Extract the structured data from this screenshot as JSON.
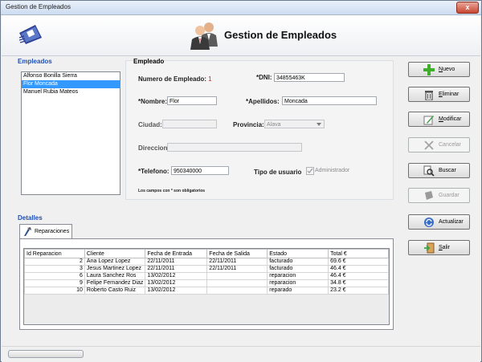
{
  "window": {
    "title": "Gestion de Empleados",
    "close_glyph": "x"
  },
  "header": {
    "title": "Gestion de Empleados"
  },
  "employees": {
    "section_label": "Empleados",
    "items": [
      {
        "label": "Alfonso Bonilla Sierra",
        "selected": false
      },
      {
        "label": "Flor Moncada",
        "selected": true
      },
      {
        "label": "Manuel Rubia Mateos",
        "selected": false
      }
    ]
  },
  "form": {
    "section_label": "Empleado",
    "numero_label": "Numero de Empleado:",
    "numero_value": "1",
    "dni_label": "*DNI:",
    "dni_value": "34855463K",
    "nombre_label": "*Nombre:",
    "nombre_value": "Flor",
    "apellidos_label": "*Apellidos:",
    "apellidos_value": "Moncada",
    "ciudad_label": "Ciudad:",
    "ciudad_value": "",
    "provincia_label": "Provincia:",
    "provincia_value": "Alava",
    "direccion_label": "Direccion:",
    "direccion_value": "",
    "telefono_label": "*Telefono:",
    "telefono_value": "950340000",
    "tipo_label": "Tipo de usuario",
    "admin_label": "Administrador",
    "admin_checked": true,
    "note": "Los campos con * son obligatorios"
  },
  "buttons": {
    "nuevo": {
      "first": "N",
      "rest": "uevo"
    },
    "eliminar": {
      "first": "E",
      "rest": "liminar"
    },
    "modificar": {
      "first": "M",
      "rest": "odificar"
    },
    "cancelar": "Cancelar",
    "buscar": "Buscar",
    "guardar": "Guardar",
    "actualizar": "Actualizar",
    "salir": {
      "first": "S",
      "rest": "alir"
    }
  },
  "details": {
    "section_label": "Detalles",
    "tab_label": "Reparaciones",
    "columns": [
      "Id Reparacion",
      "Cliente",
      "Fecha de Entrada",
      "Fecha de Salida",
      "Estado",
      "Total €"
    ],
    "rows": [
      [
        "2",
        "Ana Lopez Lopez",
        "22/11/2011",
        "22/11/2011",
        "facturado",
        "69.6 €"
      ],
      [
        "3",
        "Jesus Martinez Lopez",
        "22/11/2011",
        "22/11/2011",
        "facturado",
        "46.4 €"
      ],
      [
        "6",
        "Laura Sanchez Ros",
        "13/02/2012",
        "",
        "reparacion",
        "46.4 €"
      ],
      [
        "9",
        "Felipe Fernandez Diaz",
        "13/02/2012",
        "",
        "reparacion",
        "34.8 €"
      ],
      [
        "10",
        "Roberto Casto Ruiz",
        "13/02/2012",
        "",
        "reparado",
        "23.2 €"
      ]
    ]
  },
  "colors": {
    "accent": "#1f4fb5",
    "selection": "#3399ff",
    "required": "#d42020"
  },
  "icons": {
    "logo": "card-logo-icon",
    "header": "people-icon",
    "nuevo": "plus-icon",
    "eliminar": "trash-icon",
    "modificar": "pencil-icon",
    "cancelar": "x-icon",
    "buscar": "search-icon",
    "guardar": "save-icon",
    "actualizar": "refresh-icon",
    "salir": "exit-icon",
    "tab": "tools-icon"
  }
}
